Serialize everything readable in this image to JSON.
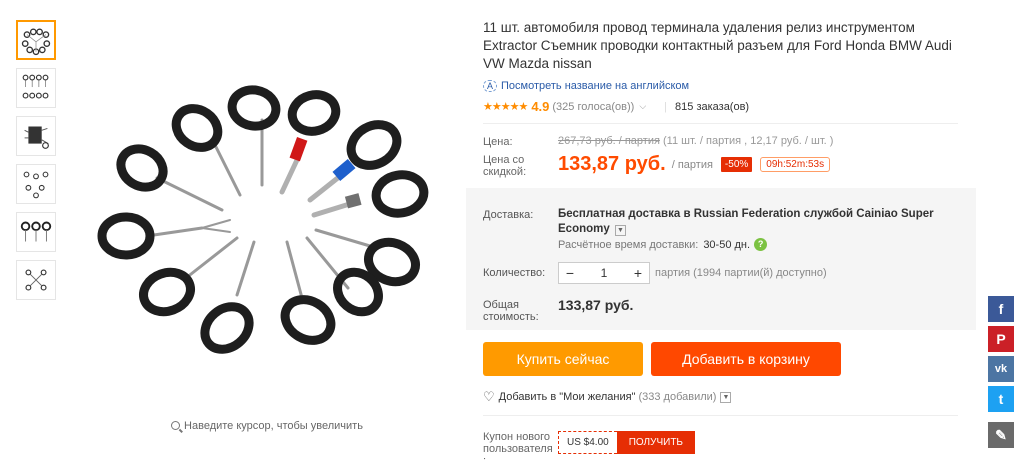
{
  "gallery": {
    "zoom_hint": "Наведите курсор, чтобы увеличить"
  },
  "product": {
    "title": "11 шт. автомобиля провод терминала удаления релиз инструментом Extractor Съемник проводки контактный разъем для Ford Honda BMW Audi VW Mazda nissan",
    "translate_link": "Посмотреть название на английском",
    "rating": {
      "stars": "★★★★★",
      "score": "4.9",
      "votes": "(325 голоса(ов))",
      "orders": "815 заказа(ов)"
    }
  },
  "price": {
    "label": "Цена:",
    "old": "267,73 руб. / партия",
    "old_details": "(11 шт. / партия , 12,17 руб. / шт. )",
    "discount_label_1": "Цена со",
    "discount_label_2": "скидкой:",
    "new": "133,87 руб.",
    "unit": "/ партия",
    "discount": "-50%",
    "timer": "09h:52m:53s"
  },
  "shipping": {
    "label": "Доставка:",
    "text_1": "Бесплатная доставка в",
    "country": "Russian Federation",
    "text_2": "службой Cainiao Super Economy",
    "time_label": "Расчётное время доставки:",
    "time_value": "30-50 дн."
  },
  "quantity": {
    "label": "Количество:",
    "minus": "−",
    "value": "1",
    "plus": "+",
    "note": "партия (1994 партии(й) доступно)"
  },
  "total": {
    "label_1": "Общая",
    "label_2": "стоимость:",
    "value": "133,87 руб."
  },
  "actions": {
    "buy_now": "Купить сейчас",
    "add_to_cart": "Добавить в корзину",
    "wishlist": "Добавить в \"Мои желания\"",
    "wishlist_count": "(333 добавили)"
  },
  "coupon": {
    "label_1": "Купон нового",
    "label_2": "пользователя",
    "label_3": ":",
    "value": "US $4.00",
    "button": "ПОЛУЧИТЬ"
  },
  "social": {
    "facebook": "f",
    "pinterest": "P",
    "vk": "vk",
    "twitter": "t",
    "edit": "✎"
  },
  "colors": {
    "price": "#ff4b00",
    "buy_now": "#ff9a00",
    "add_to_cart": "#ff4800",
    "discount": "#e62e04",
    "stars": "#ff8c00",
    "link": "#2a5ba8"
  }
}
